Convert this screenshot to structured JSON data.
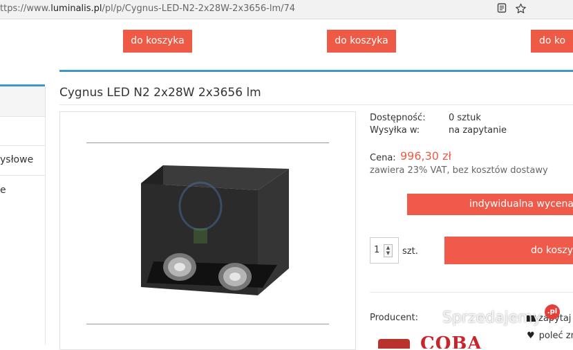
{
  "browser": {
    "url_prefix": "ttps://www.",
    "url_domain": "luminalis.pl",
    "url_path": "/pl/p/Cygnus-LED-N2-2x28W-2x3656-lm/74",
    "reader_icon": "reader-view-icon",
    "bookmark_icon": "star-icon"
  },
  "related": {
    "buttons": [
      "do koszyka",
      "do koszyka",
      "do ko"
    ]
  },
  "sidebar": {
    "items": [
      "ysłowe",
      "e"
    ]
  },
  "product": {
    "title": "Cygnus LED N2 2x28W 2x3656 lm",
    "availability_label": "Dostępność:",
    "availability_value": "0 sztuk",
    "shipping_label": "Wysyłka w:",
    "shipping_value": "na zapytanie",
    "price_label": "Cena:",
    "price": "996,30 zł",
    "vat_note": "zawiera 23% VAT, bez kosztów dostawy",
    "quote_button": "indywidualna wycena",
    "quantity": "1",
    "quantity_unit": "szt.",
    "cart_button": "do koszyk",
    "producer_label": "Producent:",
    "producer_logo_text": "COBA",
    "ask_link": "zapytaj",
    "recommend_link": "poleć zn"
  },
  "overlay": {
    "watermark": "Sprzedajemy",
    "badge": ".pl"
  },
  "colors": {
    "accent_red": "#ee5a46",
    "accent_blue": "#3d97c9",
    "price_red": "#ee5a46"
  }
}
